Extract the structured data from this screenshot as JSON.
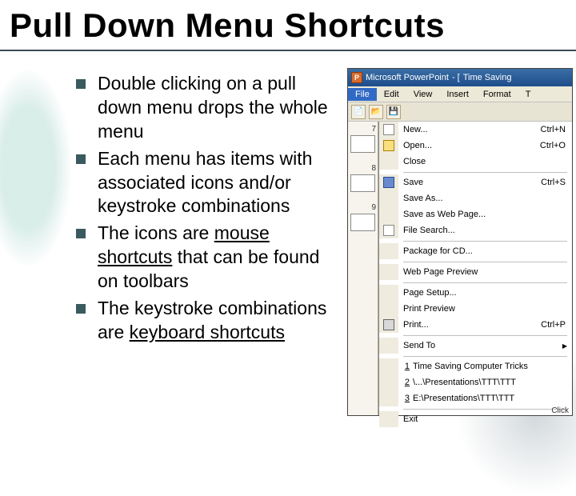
{
  "title": "Pull Down Menu Shortcuts",
  "bullets": [
    {
      "text_before": "Double clicking on a pull down menu drops the whole menu",
      "underlined": "",
      "text_after": ""
    },
    {
      "text_before": "Each menu has items with associated icons and/or keystroke combinations",
      "underlined": "",
      "text_after": ""
    },
    {
      "text_before": "The icons are ",
      "underlined": "mouse shortcuts",
      "text_after": " that can be found on toolbars"
    },
    {
      "text_before": "The keystroke combinations are ",
      "underlined": "keyboard shortcuts",
      "text_after": ""
    }
  ],
  "screenshot": {
    "titlebar": {
      "app": "Microsoft PowerPoint",
      "doc": "Time Saving"
    },
    "menubar": [
      "File",
      "Edit",
      "View",
      "Insert",
      "Format",
      "T"
    ],
    "active_menu_index": 0,
    "thumbs": [
      "7",
      "8",
      "9"
    ],
    "menu": {
      "items": [
        {
          "kind": "item",
          "icon": "new",
          "label": "New...",
          "shortcut": "Ctrl+N"
        },
        {
          "kind": "item",
          "icon": "open",
          "label": "Open...",
          "shortcut": "Ctrl+O"
        },
        {
          "kind": "item",
          "icon": "",
          "label": "Close",
          "shortcut": ""
        },
        {
          "kind": "sep"
        },
        {
          "kind": "item",
          "icon": "save",
          "label": "Save",
          "shortcut": "Ctrl+S"
        },
        {
          "kind": "item",
          "icon": "",
          "label": "Save As...",
          "shortcut": ""
        },
        {
          "kind": "item",
          "icon": "",
          "label": "Save as Web Page...",
          "shortcut": ""
        },
        {
          "kind": "item",
          "icon": "search",
          "label": "File Search...",
          "shortcut": ""
        },
        {
          "kind": "sep"
        },
        {
          "kind": "item",
          "icon": "",
          "label": "Package for CD...",
          "shortcut": ""
        },
        {
          "kind": "sep"
        },
        {
          "kind": "item",
          "icon": "",
          "label": "Web Page Preview",
          "shortcut": ""
        },
        {
          "kind": "sep"
        },
        {
          "kind": "item",
          "icon": "",
          "label": "Page Setup...",
          "shortcut": ""
        },
        {
          "kind": "item",
          "icon": "",
          "label": "Print Preview",
          "shortcut": ""
        },
        {
          "kind": "item",
          "icon": "print",
          "label": "Print...",
          "shortcut": "Ctrl+P"
        },
        {
          "kind": "sep"
        },
        {
          "kind": "sub",
          "icon": "",
          "label": "Send To",
          "shortcut": ""
        },
        {
          "kind": "sep"
        },
        {
          "kind": "recent",
          "num": "1",
          "label": "Time Saving Computer Tricks"
        },
        {
          "kind": "recent",
          "num": "2",
          "label": "\\...\\Presentations\\TTT\\TTT"
        },
        {
          "kind": "recent",
          "num": "3",
          "label": "E:\\Presentations\\TTT\\TTT"
        },
        {
          "kind": "sep"
        },
        {
          "kind": "item",
          "icon": "",
          "label": "Exit",
          "shortcut": ""
        }
      ]
    },
    "bottom_text": "Click"
  }
}
